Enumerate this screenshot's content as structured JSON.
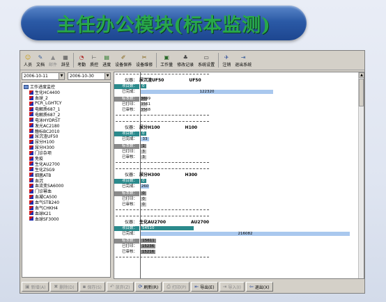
{
  "banner": {
    "title": "主任办公模块(标本监测)"
  },
  "toolbar": {
    "buttons": [
      {
        "label": "人员",
        "icon": "person-icon",
        "disabled": false
      },
      {
        "label": "文档",
        "icon": "document-icon",
        "disabled": false
      },
      {
        "label": "邮件",
        "icon": "mail-icon",
        "disabled": true
      },
      {
        "label": "辞呈",
        "icon": "form-icon",
        "disabled": false
      },
      {
        "label": "考勤",
        "icon": "attendance-icon",
        "disabled": false
      },
      {
        "label": "质控",
        "icon": "quality-icon",
        "disabled": false
      },
      {
        "label": "进度",
        "icon": "progress-icon",
        "disabled": false
      },
      {
        "label": "设备保养",
        "icon": "maintenance-icon",
        "disabled": false
      },
      {
        "label": "设备维修",
        "icon": "repair-icon",
        "disabled": false
      },
      {
        "label": "工作量",
        "icon": "workload-icon",
        "disabled": false
      },
      {
        "label": "修改记录",
        "icon": "record-icon",
        "disabled": false
      },
      {
        "label": "系统设置",
        "icon": "settings-icon",
        "disabled": false
      },
      {
        "label": "注销",
        "icon": "logout-icon",
        "disabled": false
      },
      {
        "label": "退出系统",
        "icon": "exit-icon",
        "disabled": false
      }
    ]
  },
  "date_range": {
    "from": "2006-10-11",
    "to": "2006-10-30"
  },
  "tree": {
    "root": "工作进度监控",
    "children": [
      "生化HC4400",
      "血球_2",
      "PCR_LGHTCY",
      "电解质687_1",
      "电解质687_2",
      "电泳HYDRST",
      "发光AC2180",
      "酶标BC2010",
      "尿沉渣UF50",
      "尿分H100",
      "尿分H300",
      "门诊杂项",
      "免疫",
      "生化AU2700",
      "生化ZSG9",
      "细菌ATB",
      "血沉",
      "血流变SA6000",
      "门诊幂血",
      "血凝CA500",
      "血气STB240",
      "血气CHKH4",
      "血球K21",
      "血球SF3000"
    ]
  },
  "panels": [
    {
      "instrument_label": "仪器：",
      "instrument": "尿沉渣UF50",
      "code": "UF50",
      "rows": [
        {
          "label": "项目数：",
          "value": "0",
          "style": "teal"
        },
        {
          "label": "已完成：",
          "value": "122320",
          "style": "blue"
        },
        {
          "label": "标本数：",
          "value": "3699",
          "style": "gray"
        },
        {
          "label": "已打印：",
          "value": "3561",
          "style": "lgray"
        },
        {
          "label": "已审核：",
          "value": "3568",
          "style": "lgray"
        }
      ]
    },
    {
      "instrument_label": "仪器：",
      "instrument": "尿分H100",
      "code": "H100",
      "rows": [
        {
          "label": "项目数：",
          "value": "0",
          "style": "teal"
        },
        {
          "label": "已完成：",
          "value": "33",
          "style": "blue"
        },
        {
          "label": "标本数：",
          "value": "1",
          "style": "gray"
        },
        {
          "label": "已打印：",
          "value": "3",
          "style": "lgray"
        },
        {
          "label": "已审核：",
          "value": "3",
          "style": "lgray"
        }
      ]
    },
    {
      "instrument_label": "仪器：",
      "instrument": "尿分H300",
      "code": "H300",
      "rows": [
        {
          "label": "项目数：",
          "value": "0",
          "style": "teal"
        },
        {
          "label": "已完成：",
          "value": "260",
          "style": "blue"
        },
        {
          "label": "标本数：",
          "value": "0",
          "style": "gray"
        },
        {
          "label": "已打印：",
          "value": "0",
          "style": "lgray"
        },
        {
          "label": "已审核：",
          "value": "0",
          "style": "lgray"
        }
      ]
    },
    {
      "instrument_label": "仪器：",
      "instrument": "生化AU2700",
      "code": "AU2700",
      "rows": [
        {
          "label": "项目数：",
          "value": "54510",
          "style": "teal"
        },
        {
          "label": "已完成：",
          "value": "216082",
          "style": "blue"
        },
        {
          "label": "标本数：",
          "value": "15611",
          "style": "gray"
        },
        {
          "label": "已打印：",
          "value": "15236",
          "style": "gray"
        },
        {
          "label": "已审核：",
          "value": "15216",
          "style": "gray"
        }
      ]
    }
  ],
  "bottom_buttons": [
    {
      "label": "新增(A)",
      "icon": "add-icon",
      "disabled": true
    },
    {
      "label": "删除(D)",
      "icon": "delete-icon",
      "disabled": true
    },
    {
      "label": "保存(S)",
      "icon": "save-icon",
      "disabled": true
    },
    {
      "label": "放弃(Z)",
      "icon": "undo-icon",
      "disabled": true
    },
    {
      "label": "刷新(R)",
      "icon": "refresh-icon",
      "disabled": false
    },
    {
      "label": "打印(P)",
      "icon": "print-icon",
      "disabled": true
    },
    {
      "label": "导出(E)",
      "icon": "export-icon",
      "disabled": false
    },
    {
      "label": "导入(I)",
      "icon": "import-icon",
      "disabled": true
    },
    {
      "label": "退出(X)",
      "icon": "exit-icon",
      "disabled": false
    }
  ]
}
